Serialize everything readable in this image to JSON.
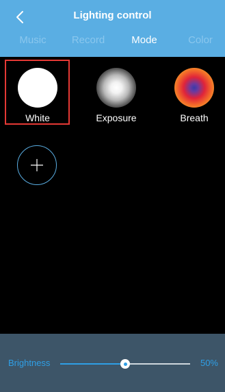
{
  "header": {
    "title": "Lighting control",
    "back_icon": "chevron-left-icon",
    "background": "#5aaee3"
  },
  "tabs": [
    {
      "label": "Music",
      "active": false
    },
    {
      "label": "Record",
      "active": false
    },
    {
      "label": "Mode",
      "active": true
    },
    {
      "label": "Color",
      "active": false
    }
  ],
  "modes": [
    {
      "label": "White",
      "selected": true
    },
    {
      "label": "Exposure",
      "selected": false
    },
    {
      "label": "Breath",
      "selected": false
    }
  ],
  "add_mode": {
    "icon": "plus-icon"
  },
  "brightness": {
    "label": "Brightness",
    "value_text": "50%",
    "value": 0.5,
    "accent": "#2f9fe6"
  },
  "colors": {
    "selection_frame": "#e53935",
    "footer": "#3d5568"
  }
}
